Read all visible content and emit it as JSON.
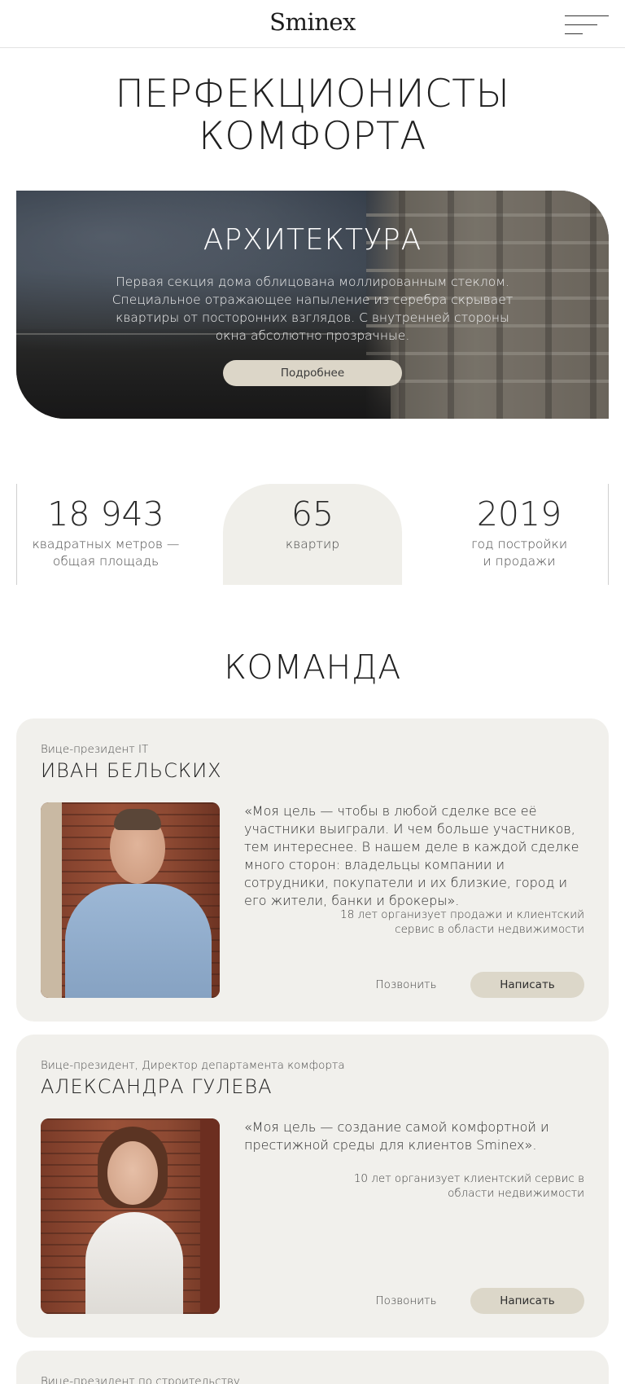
{
  "header": {
    "logo": "Sminex",
    "menu_icon": "menu-icon"
  },
  "hero": {
    "title_line1": "ПЕРФЕКЦИОНИСТЫ",
    "title_line2": "КОМФОРТА"
  },
  "architecture": {
    "title": "АРХИТЕКТУРА",
    "text": "Первая секция дома облицована моллированным стеклом. Специальное отражающее напыление из серебра скрывает квартиры от посторонних взглядов. С внутренней стороны окна абсолютно прозрачные.",
    "button_label": "Подробнее"
  },
  "stats": [
    {
      "value": "18 943",
      "label_line1": "квадратных метров —",
      "label_line2": "общая площадь"
    },
    {
      "value": "65",
      "label_line1": "квартир",
      "label_line2": ""
    },
    {
      "value": "2019",
      "label_line1": "год постройки",
      "label_line2": "и продажи"
    }
  ],
  "team": {
    "title": "КОМАНДА",
    "members": [
      {
        "role": "Вице-президент IT",
        "name": "ИВАН БЕЛЬСКИХ",
        "quote": "«Моя цель — чтобы в любой сделке все её участники выиграли. И чем больше участников, тем интереснее. В нашем деле в каждой сделке много сторон: владельцы компании и сотрудники, покупатели и их близкие, город и его жители, банки и брокеры».",
        "experience": "18 лет организует продажи и клиентский сервис в области недвижимости",
        "call_label": "Позвонить",
        "write_label": "Написать"
      },
      {
        "role": "Вице-президент, Директор департамента комфорта",
        "name": "АЛЕКСАНДРА ГУЛЕВА",
        "quote": "«Моя цель — создание самой комфортной и престижной среды для клиентов Sminex».",
        "experience": "10 лет организует клиентский сервис в области недвижимости",
        "call_label": "Позвонить",
        "write_label": "Написать"
      },
      {
        "role": "Вице-президент по строительству"
      }
    ]
  },
  "colors": {
    "card_bg": "#f1f0ec",
    "button_beige": "#dcd7c9",
    "text_dark": "#222222"
  }
}
